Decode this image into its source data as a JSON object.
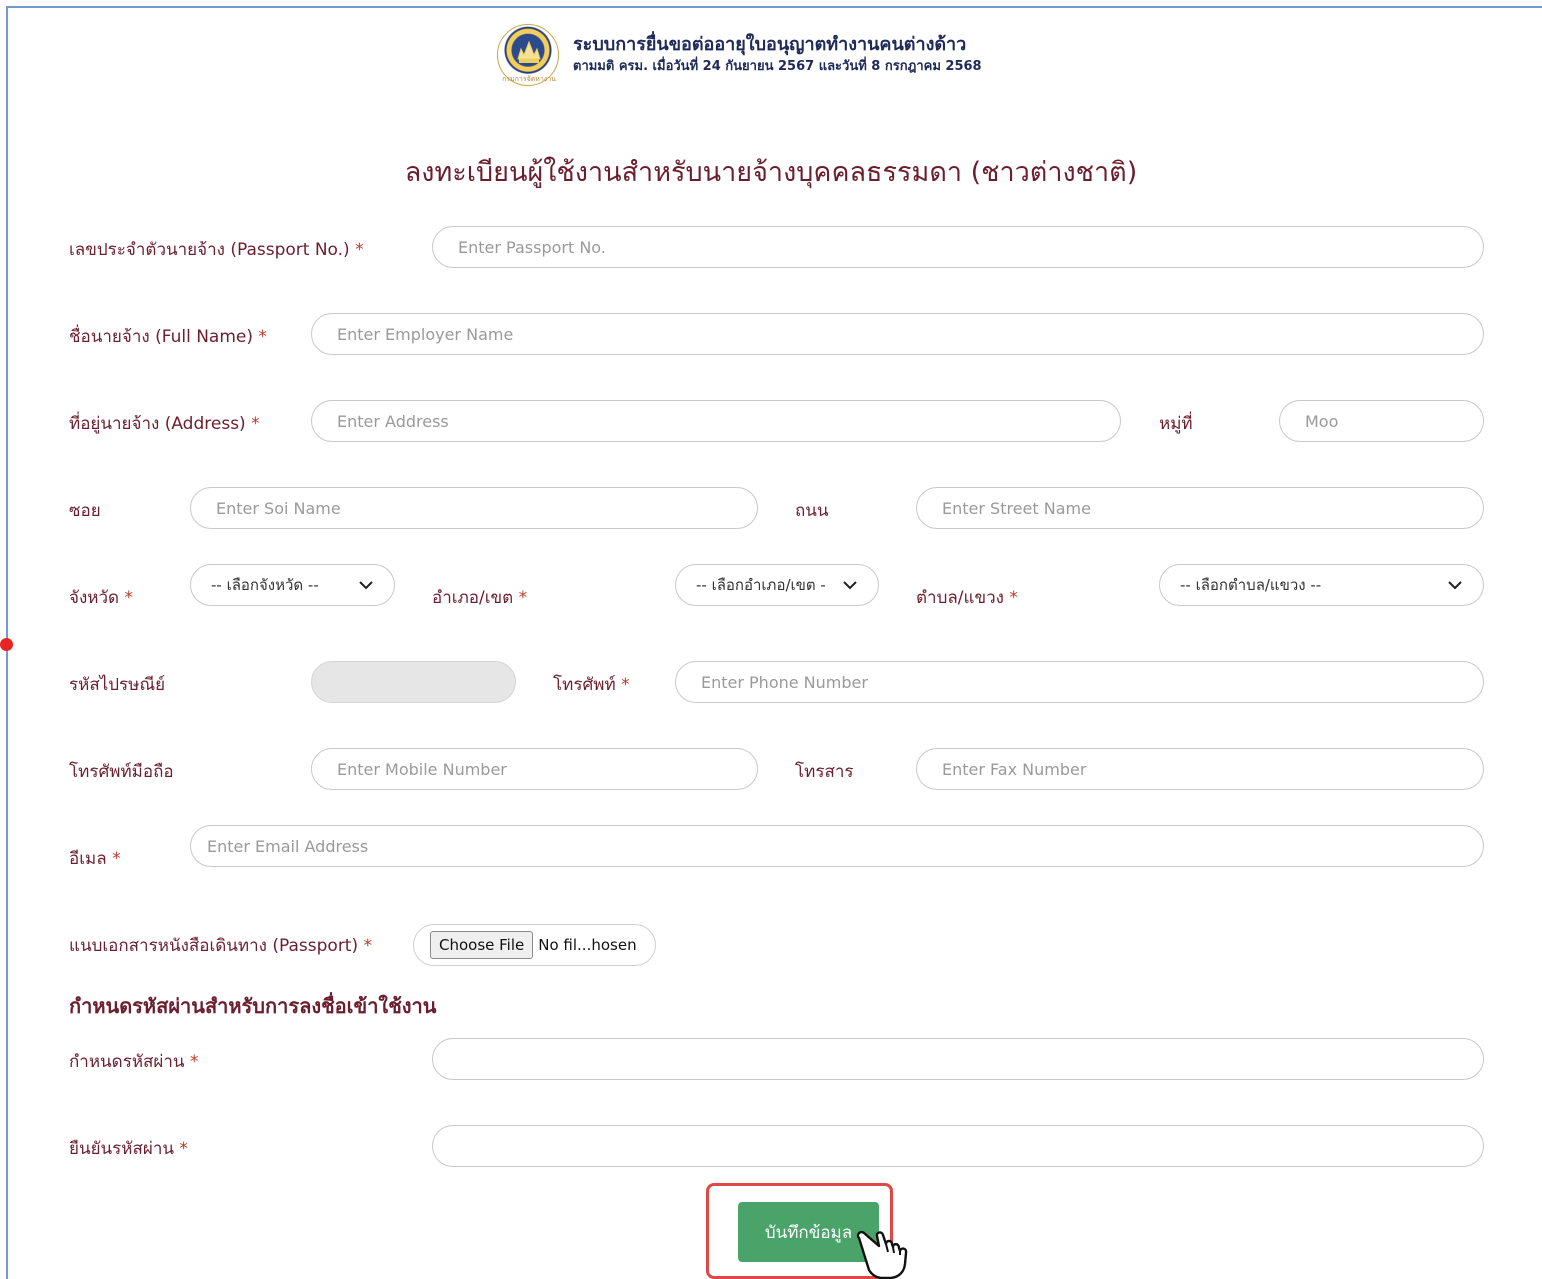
{
  "header": {
    "title": "ระบบการยื่นขอต่ออายุใบอนุญาตทำงานคนต่างด้าว",
    "subtitle": "ตามมติ ครม. เมื่อวันที่ 24 กันยายน 2567 และวันที่ 8 กรกฎาคม 2568",
    "seal_text": "กรมการจัดหางาน"
  },
  "page_title": "ลงทะเบียนผู้ใช้งานสำหรับนายจ้างบุคคลธรรมดา (ชาวต่างชาติ)",
  "required_mark": "*",
  "form": {
    "passport": {
      "label": "เลขประจำตัวนายจ้าง (Passport No.)",
      "placeholder": "Enter Passport No.",
      "value": ""
    },
    "full_name": {
      "label": "ชื่อนายจ้าง (Full Name)",
      "placeholder": "Enter Employer Name",
      "value": ""
    },
    "address": {
      "label": "ที่อยู่นายจ้าง (Address)",
      "placeholder": "Enter Address",
      "value": ""
    },
    "moo": {
      "label": "หมู่ที่",
      "placeholder": "Moo",
      "value": ""
    },
    "soi": {
      "label": "ซอย",
      "placeholder": "Enter Soi Name",
      "value": ""
    },
    "street": {
      "label": "ถนน",
      "placeholder": "Enter Street Name",
      "value": ""
    },
    "province": {
      "label": "จังหวัด",
      "selected": "-- เลือกจังหวัด --"
    },
    "district": {
      "label": "อำเภอ/เขต",
      "selected": "-- เลือกอำเภอ/เขต -"
    },
    "subdistrict": {
      "label": "ตำบล/แขวง",
      "selected": "-- เลือกตำบล/แขวง --"
    },
    "postcode": {
      "label": "รหัสไปรษณีย์",
      "value": ""
    },
    "phone": {
      "label": "โทรศัพท์",
      "placeholder": "Enter Phone Number",
      "value": ""
    },
    "mobile": {
      "label": "โทรศัพท์มือถือ",
      "placeholder": "Enter Mobile Number",
      "value": ""
    },
    "fax": {
      "label": "โทรสาร",
      "placeholder": "Enter Fax Number",
      "value": ""
    },
    "email": {
      "label": "อีเมล",
      "placeholder": "Enter Email Address",
      "value": ""
    },
    "attachment": {
      "label": "แนบเอกสารหนังสือเดินทาง (Passport)",
      "button": "Choose File",
      "file_name": "No fil...hosen"
    }
  },
  "password_section": {
    "heading": "กำหนดรหัสผ่านสำหรับการลงชื่อเข้าใช้งาน",
    "password_label": "กำหนดรหัสผ่าน",
    "confirm_label": "ยืนยันรหัสผ่าน"
  },
  "save_button": "บันทึกข้อมูล",
  "colors": {
    "label_text": "#6b1e2e",
    "required": "#c0392b",
    "save_button": "#4aa46a",
    "highlight": "#e04848",
    "header_text": "#1f2a5a"
  }
}
